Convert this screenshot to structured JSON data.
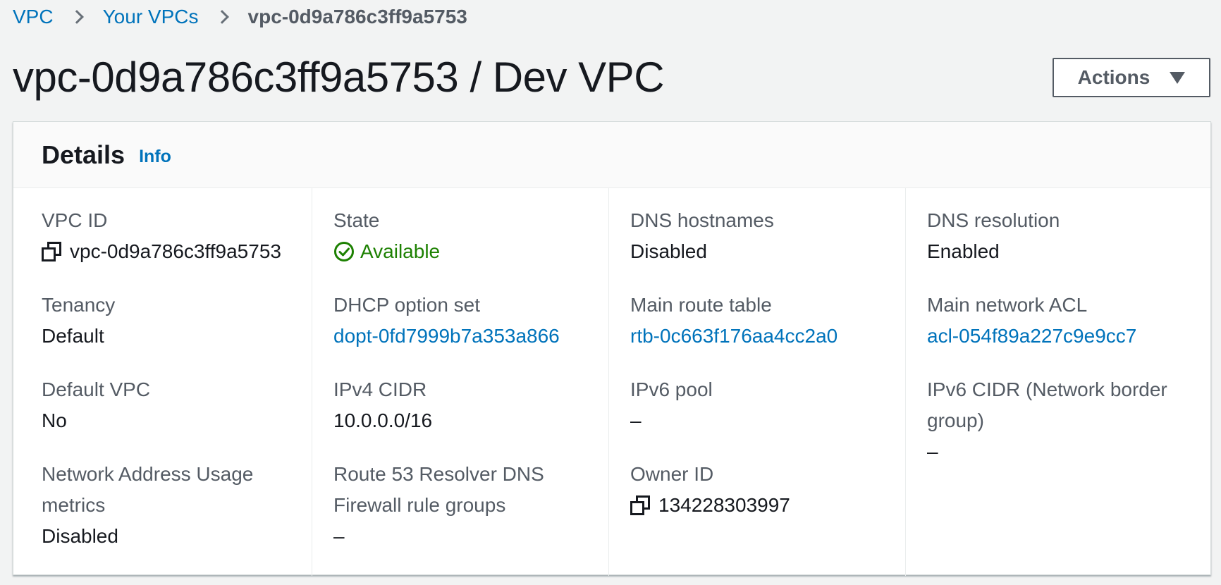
{
  "breadcrumb": {
    "items": [
      "VPC",
      "Your VPCs"
    ],
    "current": "vpc-0d9a786c3ff9a5753"
  },
  "page": {
    "title": "vpc-0d9a786c3ff9a5753 / Dev VPC",
    "actions_label": "Actions"
  },
  "details": {
    "title": "Details",
    "info_label": "Info",
    "status_color": "#1d8102",
    "link_color": "#0073bb",
    "columns": [
      [
        {
          "label": "VPC ID",
          "value": "vpc-0d9a786c3ff9a5753",
          "icon": "copy-icon"
        },
        {
          "label": "Tenancy",
          "value": "Default"
        },
        {
          "label": "Default VPC",
          "value": "No"
        },
        {
          "label": "Network Address Usage metrics",
          "value": "Disabled"
        }
      ],
      [
        {
          "label": "State",
          "value": "Available",
          "icon": "check-circle-icon"
        },
        {
          "label": "DHCP option set",
          "value": "dopt-0fd7999b7a353a866"
        },
        {
          "label": "IPv4 CIDR",
          "value": "10.0.0.0/16"
        },
        {
          "label": "Route 53 Resolver DNS Firewall rule groups",
          "value": "–"
        }
      ],
      [
        {
          "label": "DNS hostnames",
          "value": "Disabled"
        },
        {
          "label": "Main route table",
          "value": "rtb-0c663f176aa4cc2a0"
        },
        {
          "label": "IPv6 pool",
          "value": "–"
        },
        {
          "label": "Owner ID",
          "value": "134228303997",
          "icon": "copy-icon"
        }
      ],
      [
        {
          "label": "DNS resolution",
          "value": "Enabled"
        },
        {
          "label": "Main network ACL",
          "value": "acl-054f89a227c9e9cc7"
        },
        {
          "label": "IPv6 CIDR (Network border group)",
          "value": "–"
        }
      ]
    ]
  }
}
